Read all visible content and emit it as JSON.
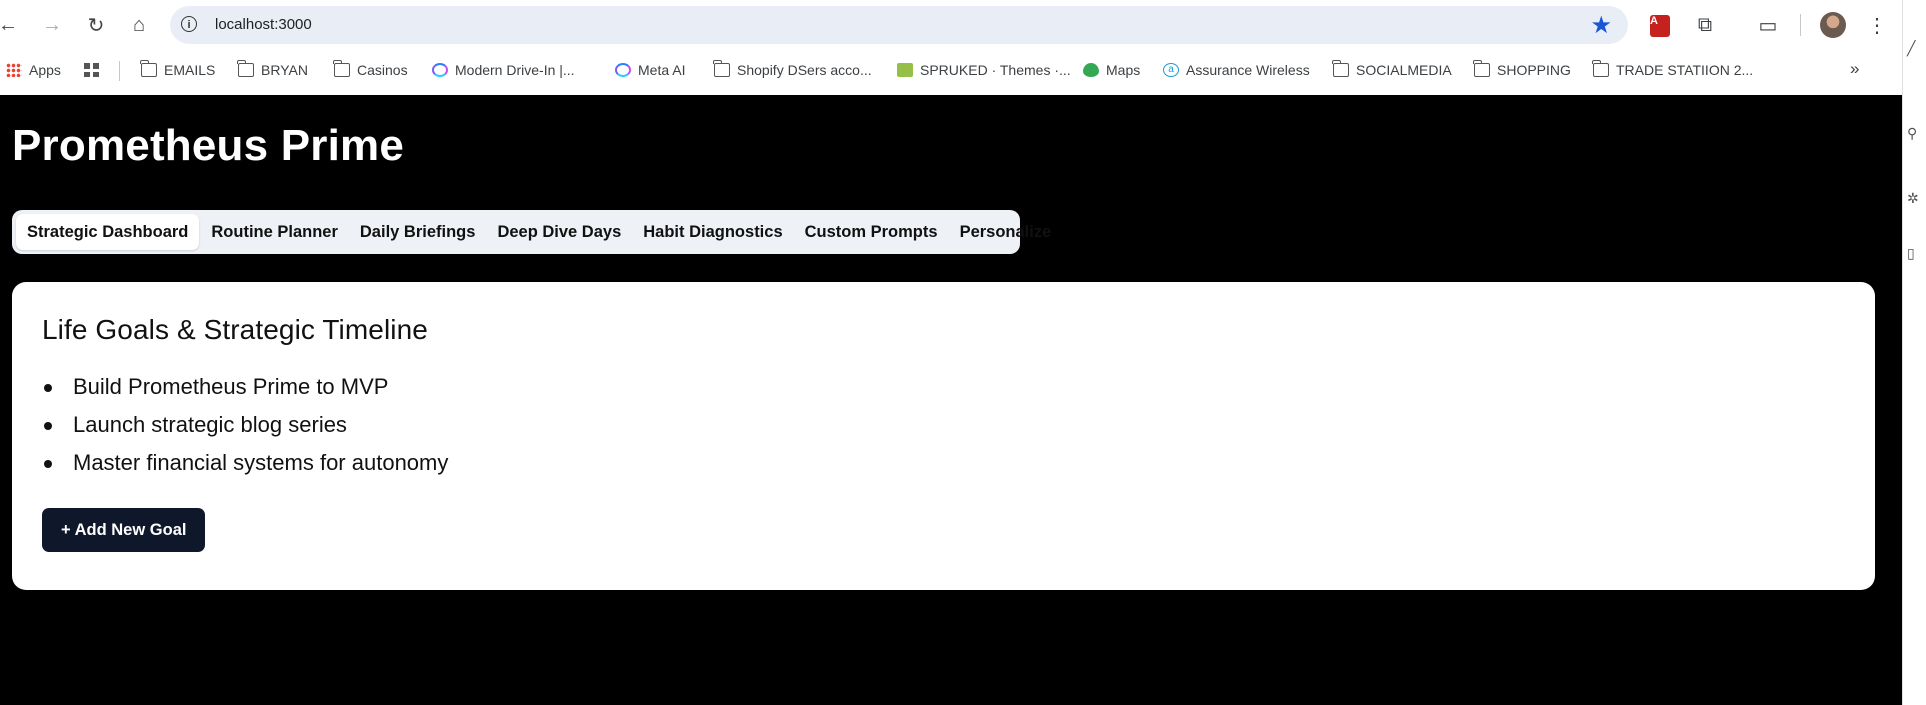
{
  "browser": {
    "url": "localhost:3000",
    "bookmarks": [
      {
        "label": "Apps",
        "icon": "apps-grid-icon"
      },
      {
        "label": "",
        "icon": "tab-groups-icon"
      },
      {
        "label": "EMAILS",
        "icon": "folder-icon"
      },
      {
        "label": "BRYAN",
        "icon": "folder-icon"
      },
      {
        "label": "Casinos",
        "icon": "folder-icon"
      },
      {
        "label": "Modern Drive-In |...",
        "icon": "meta-ai-icon"
      },
      {
        "label": "Meta AI",
        "icon": "meta-ai-icon"
      },
      {
        "label": "Shopify DSers acco...",
        "icon": "folder-icon"
      },
      {
        "label": "SPRUKED · Themes ·...",
        "icon": "shopify-icon"
      },
      {
        "label": "Maps",
        "icon": "maps-pin-icon"
      },
      {
        "label": "Assurance Wireless",
        "icon": "amazon-icon"
      },
      {
        "label": "SOCIALMEDIA",
        "icon": "folder-icon"
      },
      {
        "label": "SHOPPING",
        "icon": "folder-icon"
      },
      {
        "label": "TRADE STATIION 2...",
        "icon": "folder-icon"
      }
    ],
    "overflow": "»"
  },
  "app": {
    "title": "Prometheus Prime",
    "tabs": [
      {
        "label": "Strategic Dashboard",
        "active": true
      },
      {
        "label": "Routine Planner"
      },
      {
        "label": "Daily Briefings"
      },
      {
        "label": "Deep Dive Days"
      },
      {
        "label": "Habit Diagnostics"
      },
      {
        "label": "Custom Prompts"
      },
      {
        "label": "Personalize"
      }
    ],
    "card": {
      "heading": "Life Goals & Strategic Timeline",
      "goals": [
        "Build Prometheus Prime to MVP",
        "Launch strategic blog series",
        "Master financial systems for autonomy"
      ],
      "add_button": "+ Add New Goal"
    }
  },
  "colors": {
    "background": "#000000",
    "button": "#0f172a",
    "tab_bar": "#eef1f6"
  }
}
